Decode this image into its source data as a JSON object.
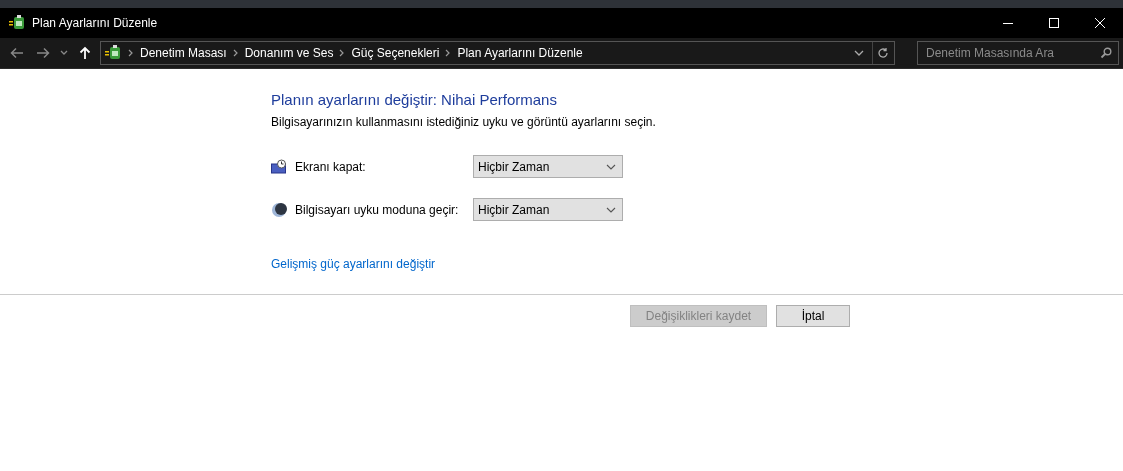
{
  "window": {
    "title": "Plan Ayarlarını Düzenle"
  },
  "address_bar": {
    "breadcrumbs": [
      "Denetim Masası",
      "Donanım ve Ses",
      "Güç Seçenekleri",
      "Plan Ayarlarını Düzenle"
    ]
  },
  "search": {
    "placeholder": "Denetim Masasında Ara"
  },
  "heading": "Planın ayarlarını değiştir: Nihai Performans",
  "description": "Bilgisayarınızın kullanmasını istediğiniz uyku ve görüntü ayarlarını seçin.",
  "settings": [
    {
      "kind": "display",
      "label": "Ekranı kapat:",
      "value": "Hiçbir Zaman"
    },
    {
      "kind": "sleep",
      "label": "Bilgisayarı uyku moduna geçir:",
      "value": "Hiçbir Zaman"
    }
  ],
  "advanced_link": "Gelişmiş güç ayarlarını değiştir",
  "buttons": [
    {
      "label": "Değişiklikleri kaydet",
      "disabled": true
    },
    {
      "label": "İptal",
      "disabled": false
    }
  ]
}
